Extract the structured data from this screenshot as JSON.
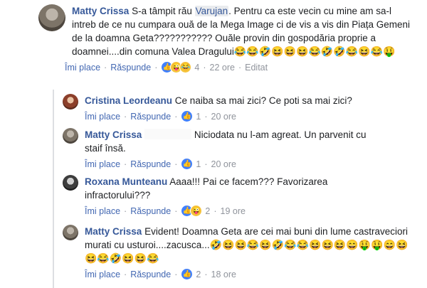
{
  "comments": [
    {
      "author": "Matty Crissa",
      "text_before": "S-a tâmpit rău ",
      "mention": "Varujan",
      "text_after": ". Pentru ca este vecin cu mine am sa-l intreb de ce nu cumpara ouă de la Mega Image ci de vis a vis din Piața Gemeni de la doamna Geta??????????? Ouăle provin din gospodăria proprie a doamnei....din comuna Valea Dragului",
      "emojis": "😂😂🤣😆😆😆😂🤣🤣😂😆😂🤑",
      "like_label": "Îmi place",
      "reply_label": "Răspunde",
      "reaction_icons": [
        "👍",
        "😜",
        "😂"
      ],
      "reaction_count": "4",
      "time": "22 ore",
      "edited": "Editat"
    },
    {
      "author": "Cristina Leordeanu",
      "text": "Ce naiba sa mai zici? Ce poti sa mai zici?",
      "like_label": "Îmi place",
      "reply_label": "Răspunde",
      "reaction_icons": [
        "👍"
      ],
      "reaction_count": "1",
      "time": "20 ore"
    },
    {
      "author": "Matty Crissa",
      "text": "Niciodata nu l-am agreat. Un parvenit cu staif însă.",
      "like_label": "Îmi place",
      "reply_label": "Răspunde",
      "reaction_icons": [
        "👍"
      ],
      "reaction_count": "1",
      "time": "20 ore"
    },
    {
      "author": "Roxana Munteanu",
      "text": "Aaaa!!! Pai ce facem??? Favorizarea infractorului???",
      "like_label": "Îmi place",
      "reply_label": "Răspunde",
      "reaction_icons": [
        "👍",
        "😜"
      ],
      "reaction_count": "2",
      "time": "19 ore"
    },
    {
      "author": "Matty Crissa",
      "text": "Evident! Doamna Geta are cei mai buni din lume castraveciori murati cu usturoi....zacusca...",
      "emojis": "🤣😆😆😂😆🤣😂😂😆😆😆😄🤑🤑😄😆😆😂🤣😆😆😂",
      "like_label": "Îmi place",
      "reply_label": "Răspunde",
      "reaction_icons": [
        "👍"
      ],
      "reaction_count": "2",
      "time": "18 ore"
    }
  ]
}
